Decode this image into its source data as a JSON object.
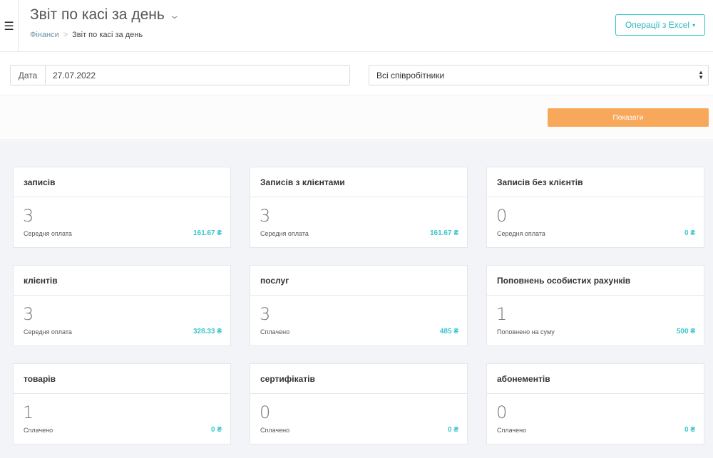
{
  "header": {
    "menu_icon": "hamburger-icon",
    "title": "Звіт по касі за день",
    "title_chevron": "chevron-down-icon",
    "breadcrumb": {
      "parent": "Фінанси",
      "separator": ">",
      "current": "Звіт по касі за день"
    },
    "excel_button": "Операції з Excel",
    "excel_caret": "▾"
  },
  "filters": {
    "date_label": "Дата",
    "date_value": "27.07.2022",
    "staff_value": "Всі співробітники"
  },
  "actions": {
    "show_button": "Показати"
  },
  "colors": {
    "accent": "#3cc6cd",
    "button": "#f8a85b",
    "background": "#f3f4f8"
  },
  "cards": [
    {
      "title": "записів",
      "value": "3",
      "sub": "Середня оплата",
      "amount": "161.67 ₴"
    },
    {
      "title": "Записів з клієнтами",
      "value": "3",
      "sub": "Середня оплата",
      "amount": "161.67 ₴"
    },
    {
      "title": "Записів без клієнтів",
      "value": "0",
      "sub": "Середня оплата",
      "amount": "0 ₴"
    },
    {
      "title": "клієнтів",
      "value": "3",
      "sub": "Середня оплата",
      "amount": "328.33 ₴"
    },
    {
      "title": "послуг",
      "value": "3",
      "sub": "Сплачено",
      "amount": "485 ₴"
    },
    {
      "title": "Поповнень особистих рахунків",
      "value": "1",
      "sub": "Поповнено на суму",
      "amount": "500 ₴"
    },
    {
      "title": "товарів",
      "value": "1",
      "sub": "Сплачено",
      "amount": "0 ₴"
    },
    {
      "title": "сертифікатів",
      "value": "0",
      "sub": "Сплачено",
      "amount": "0 ₴"
    },
    {
      "title": "абонементів",
      "value": "0",
      "sub": "Сплачено",
      "amount": "0 ₴"
    }
  ]
}
